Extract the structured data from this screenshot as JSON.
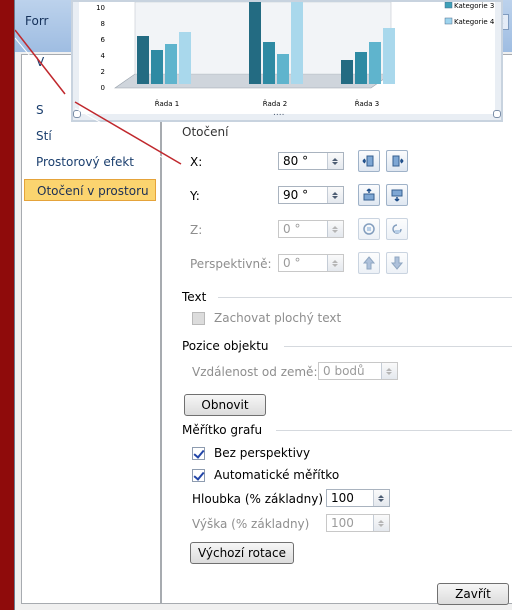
{
  "dialog": {
    "title_fragment": "Forr",
    "close_glyph": "✕"
  },
  "sidebar": {
    "items": [
      {
        "label": "V"
      },
      {
        "label": "S"
      },
      {
        "label": "Stí"
      },
      {
        "label": "Prostorový efekt"
      },
      {
        "label": "Otočení v prostoru",
        "selected": true
      }
    ]
  },
  "chart_preview": {
    "y_ticks": [
      "10",
      "8",
      "6",
      "4",
      "2",
      "0"
    ],
    "categories": [
      "Řada 1",
      "Řada 2",
      "Řada 3"
    ],
    "legend": [
      "Kategorie 3",
      "Kategorie 4"
    ],
    "legend_colors": [
      "#3ea0b8",
      "#9ed4ee"
    ],
    "resize_dots": "...."
  },
  "rotation": {
    "section_label": "Otočení",
    "x": {
      "label": "X:",
      "value": "80 °"
    },
    "y": {
      "label": "Y:",
      "value": "90 °"
    },
    "z": {
      "label": "Z:",
      "value": "0 °"
    },
    "perspective": {
      "label": "Perspektivně:",
      "value": "0 °"
    }
  },
  "text_section": {
    "label": "Text",
    "keep_flat_label": "Zachovat plochý text"
  },
  "object_position": {
    "label": "Pozice objektu",
    "distance_label": "Vzdálenost od země:",
    "distance_value": "0 bodů"
  },
  "reset_button": "Obnovit",
  "chart_scale": {
    "label": "Měřítko grafu",
    "no_perspective_label": "Bez perspektivy",
    "auto_scale_label": "Automatické měřítko",
    "depth_label": "Hloubka (% základny)",
    "depth_value": "100",
    "height_label": "Výška (% základny)",
    "height_value": "100",
    "default_rotation_button": "Výchozí rotace"
  },
  "close_button": "Zavřít"
}
